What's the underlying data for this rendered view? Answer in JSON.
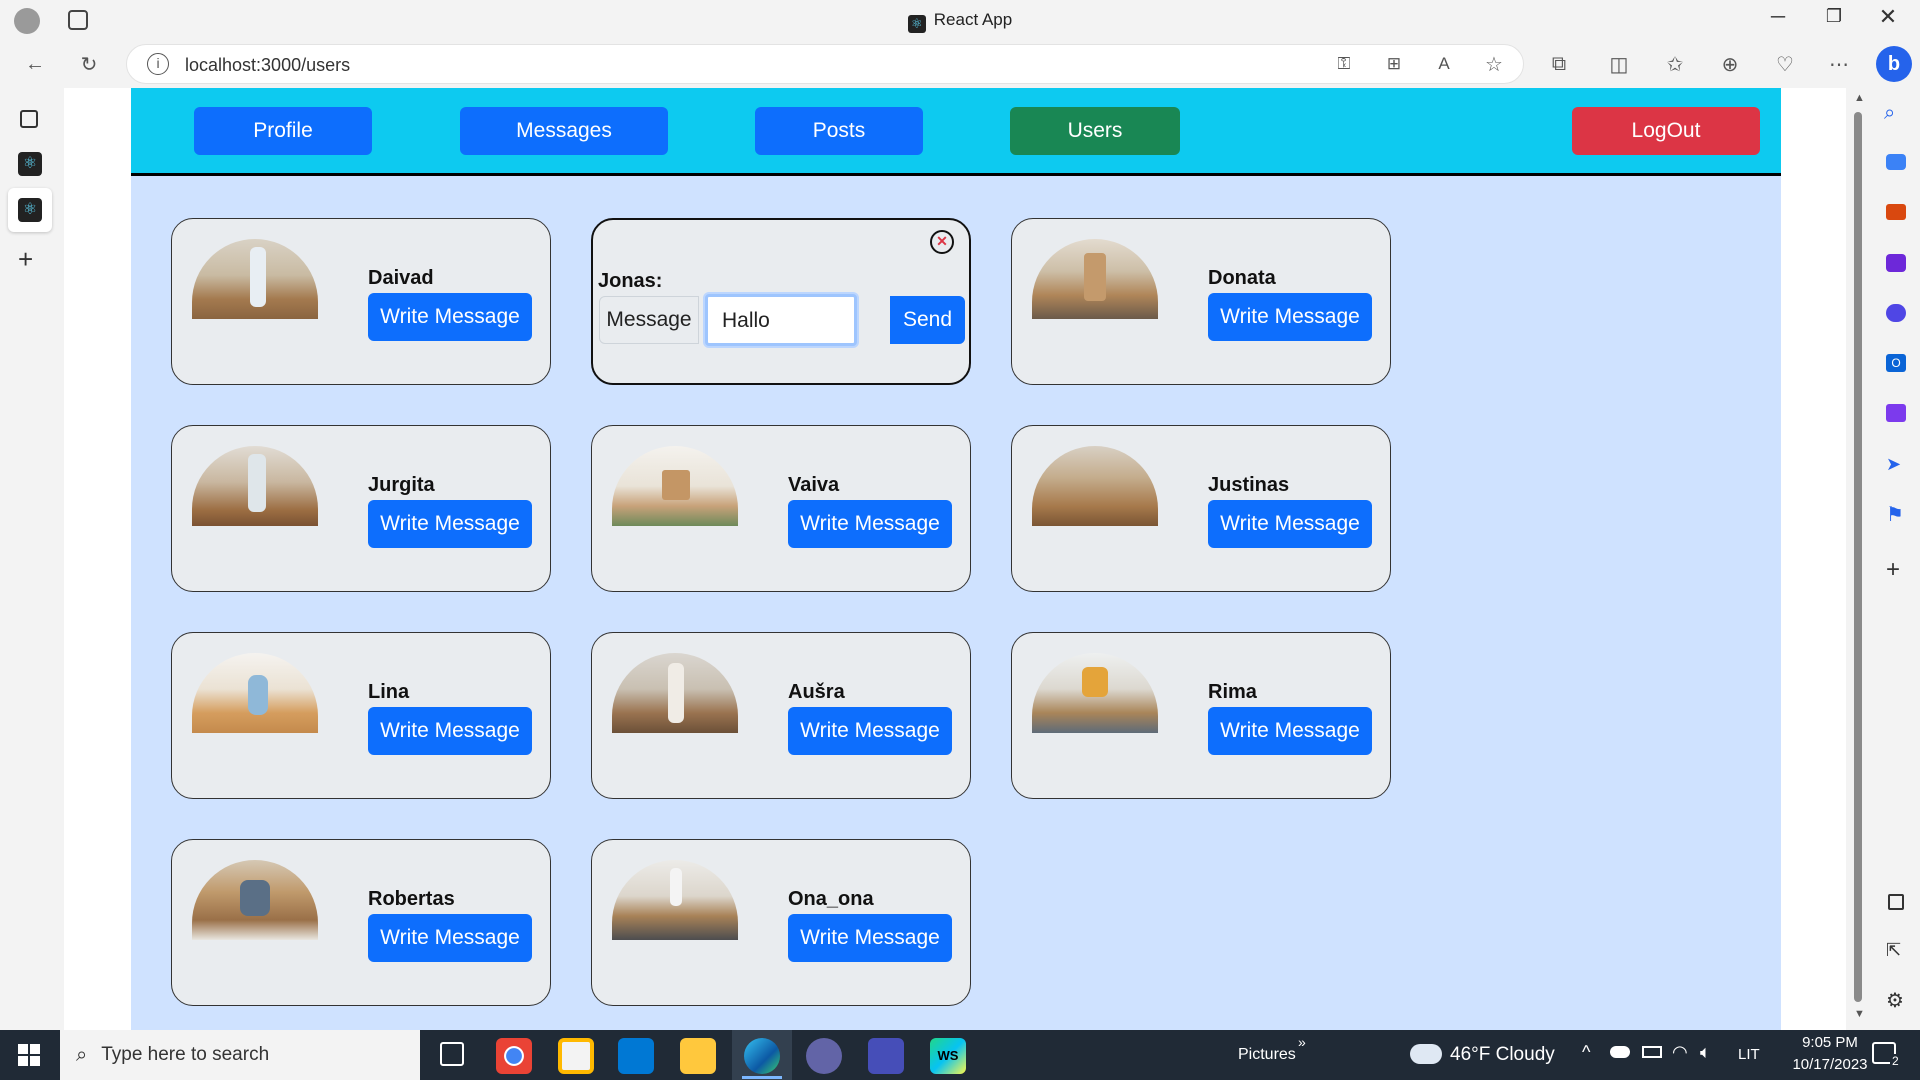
{
  "browser": {
    "title": "React App",
    "url": "localhost:3000/users"
  },
  "nav": {
    "profile": "Profile",
    "messages": "Messages",
    "posts": "Posts",
    "users": "Users",
    "logout": "LogOut"
  },
  "message_box": {
    "recipient": "Jonas:",
    "label": "Message",
    "input_value": "Hallo",
    "send": "Send"
  },
  "users": [
    {
      "name": "Daivad",
      "button": "Write Message"
    },
    {
      "name": "Donata",
      "button": "Write Message"
    },
    {
      "name": "Jurgita",
      "button": "Write Message"
    },
    {
      "name": "Vaiva",
      "button": "Write Message"
    },
    {
      "name": "Justinas",
      "button": "Write Message"
    },
    {
      "name": "Lina",
      "button": "Write Message"
    },
    {
      "name": "Aušra",
      "button": "Write Message"
    },
    {
      "name": "Rima",
      "button": "Write Message"
    },
    {
      "name": "Robertas",
      "button": "Write Message"
    },
    {
      "name": "Ona_ona",
      "button": "Write Message"
    }
  ],
  "taskbar": {
    "search_placeholder": "Type here to search",
    "pictures": "Pictures",
    "weather": "46°F  Cloudy",
    "lang": "LIT",
    "time": "9:05 PM",
    "date": "10/17/2023",
    "notifications": "2"
  },
  "colors": {
    "navbar": "#0dcaf0",
    "page_bg": "#cfe2ff",
    "primary": "#0d6efd",
    "success": "#198754",
    "danger": "#dc3545"
  }
}
